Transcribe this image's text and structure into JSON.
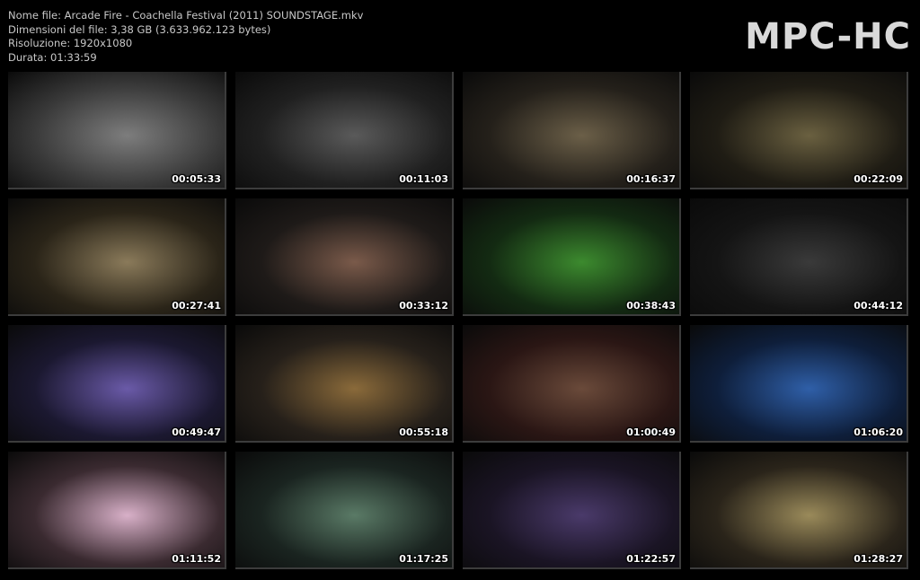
{
  "file_info": {
    "name_line": "Nome file: Arcade Fire - Coachella Festival (2011) SOUNDSTAGE.mkv",
    "size_line": "Dimensioni del file: 3,38 GB (3.633.962.123 bytes)",
    "resolution_line": "Risoluzione: 1920x1080",
    "duration_line": "Durata: 01:33:59"
  },
  "logo": "MPC-HC",
  "thumbnails": [
    {
      "time": "00:05:33",
      "bg": "#3a3a3a",
      "accent": "#7d7d7d"
    },
    {
      "time": "00:11:03",
      "bg": "#202020",
      "accent": "#5a5a5a"
    },
    {
      "time": "00:16:37",
      "bg": "#24201a",
      "accent": "#6b5f48"
    },
    {
      "time": "00:22:09",
      "bg": "#1f1c14",
      "accent": "#6a6040"
    },
    {
      "time": "00:27:41",
      "bg": "#2a2418",
      "accent": "#8a7a5a"
    },
    {
      "time": "00:33:12",
      "bg": "#1e1a18",
      "accent": "#7a5a4a"
    },
    {
      "time": "00:38:43",
      "bg": "#132a12",
      "accent": "#3c8a2e"
    },
    {
      "time": "00:44:12",
      "bg": "#141414",
      "accent": "#3a3a3a"
    },
    {
      "time": "00:49:47",
      "bg": "#1b1830",
      "accent": "#6a5aa8"
    },
    {
      "time": "00:55:18",
      "bg": "#26201a",
      "accent": "#8a6a3a"
    },
    {
      "time": "01:00:49",
      "bg": "#2a1614",
      "accent": "#6a4a3a"
    },
    {
      "time": "01:06:20",
      "bg": "#0e1e3a",
      "accent": "#2f5fa8"
    },
    {
      "time": "01:11:52",
      "bg": "#3a2a30",
      "accent": "#d8b0c8"
    },
    {
      "time": "01:17:25",
      "bg": "#1a2420",
      "accent": "#5a7a66"
    },
    {
      "time": "01:22:57",
      "bg": "#1a1424",
      "accent": "#4a3a6a"
    },
    {
      "time": "01:28:27",
      "bg": "#2a241a",
      "accent": "#9a8a5a"
    }
  ]
}
